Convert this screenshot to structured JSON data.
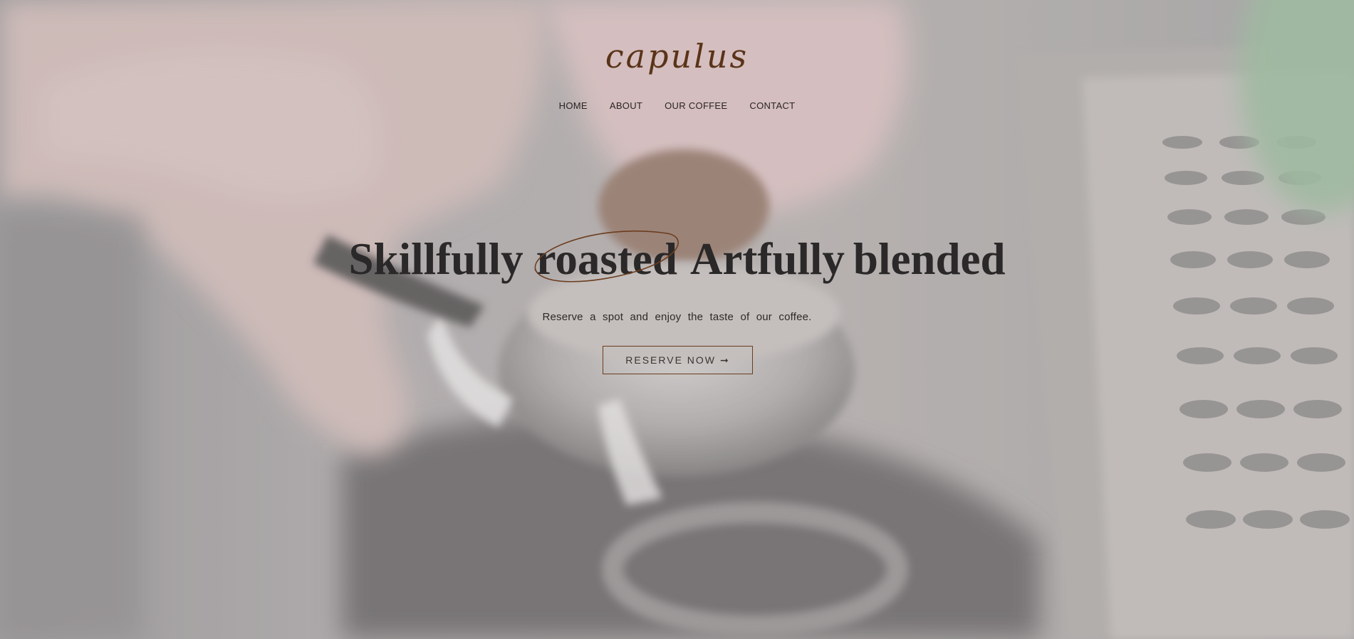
{
  "brand": {
    "logo": "capulus",
    "color": "#5a3318"
  },
  "nav": {
    "items": [
      {
        "label": "HOME"
      },
      {
        "label": "ABOUT"
      },
      {
        "label": "OUR COFFEE"
      },
      {
        "label": "CONTACT"
      }
    ]
  },
  "hero": {
    "headline_words": [
      "Skillfully",
      "roasted",
      "Artfully",
      "blended"
    ],
    "highlighted_word_index": 1,
    "subtitle": "Reserve a spot and enjoy the taste of our coffee.",
    "cta": {
      "label": "RESERVE NOW",
      "icon": "arrow-right-icon",
      "arrow": "➞"
    },
    "background": "espresso-tamping-photo"
  },
  "colors": {
    "accent": "#6b3d1f",
    "text": "#2a2828"
  }
}
